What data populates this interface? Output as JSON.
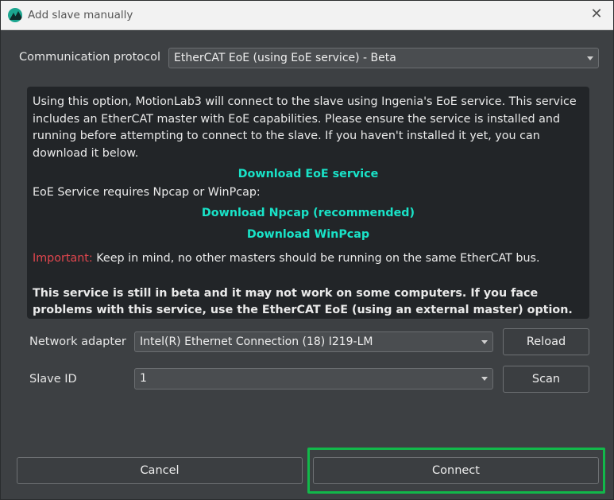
{
  "window": {
    "title": "Add slave manually",
    "close_glyph": "✕"
  },
  "protocol": {
    "label": "Communication protocol",
    "selected": "EtherCAT EoE (using EoE service) - Beta"
  },
  "info": {
    "paragraph": "Using this option, MotionLab3 will connect to the slave using Ingenia's EoE service. This service includes an EtherCAT master with EoE capabilities. Please ensure the service is installed and running before attempting to connect to the slave. If you haven't installed it yet, you can download it below.",
    "download_eoe": "Download EoE service",
    "requires": "EoE Service requires Npcap or WinPcap:",
    "download_npcap": "Download Npcap (recommended)",
    "download_winpcap": "Download WinPcap",
    "important_label": "Important:",
    "important_text": " Keep in mind, no other masters should be running on the same EtherCAT bus.",
    "beta_warning": "This service is still in beta and it may not work on some computers. If you face problems with this service, use the EtherCAT EoE (using an external master) option."
  },
  "network_adapter": {
    "label": "Network adapter",
    "selected": "Intel(R) Ethernet Connection (18) I219-LM",
    "reload_label": "Reload"
  },
  "slave_id": {
    "label": "Slave ID",
    "selected": "1",
    "scan_label": "Scan"
  },
  "footer": {
    "cancel_label": "Cancel",
    "connect_label": "Connect"
  },
  "colors": {
    "link": "#19e3c8",
    "important": "#e2464e",
    "highlight": "#12b84a"
  }
}
